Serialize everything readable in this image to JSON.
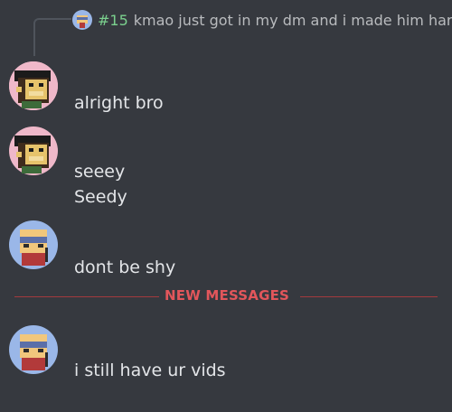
{
  "reply": {
    "mention": "#15",
    "text": "kmao just got in my dm and i made him hard",
    "avatar_icon": "cat-avatar-icon"
  },
  "messages": [
    {
      "avatar_icon": "monkey-avatar-icon",
      "lines": [
        "alright bro"
      ]
    },
    {
      "avatar_icon": "monkey-avatar-icon",
      "lines": [
        "seeey",
        "Seedy"
      ]
    },
    {
      "avatar_icon": "cat-avatar-icon",
      "lines": [
        "dont be shy"
      ]
    },
    {
      "avatar_icon": "cat-avatar-icon",
      "lines": [
        "i still have ur vids"
      ]
    }
  ],
  "divider": {
    "label": "NEW MESSAGES"
  },
  "colors": {
    "background": "#36393f",
    "mention": "#7bd18e",
    "new_messages": "#e2565b"
  }
}
